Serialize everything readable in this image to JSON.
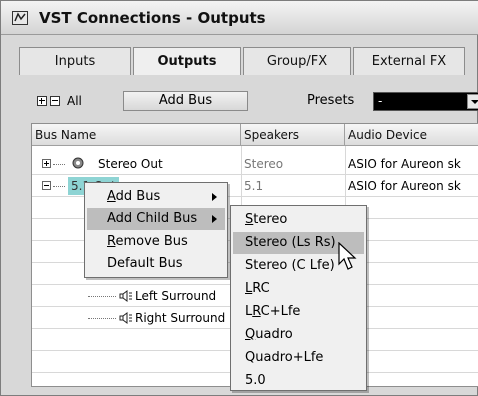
{
  "window": {
    "title": "VST Connections - Outputs"
  },
  "tabs": [
    {
      "label": "Inputs",
      "active": false
    },
    {
      "label": "Outputs",
      "active": true
    },
    {
      "label": "Group/FX",
      "active": false
    },
    {
      "label": "External FX",
      "active": false
    }
  ],
  "toolbar": {
    "all_label": "All",
    "add_bus_label": "Add Bus",
    "presets_label": "Presets",
    "presets_value": "-"
  },
  "table": {
    "headers": [
      "Bus Name",
      "Speakers",
      "Audio Device"
    ],
    "rows": [
      {
        "name": "Stereo Out",
        "speakers": "Stereo",
        "device": "ASIO for Aureon sk"
      },
      {
        "name": "5.1 Out",
        "speakers": "5.1",
        "device": "ASIO for Aureon sk"
      },
      {
        "name": "Left Surround",
        "speakers": "",
        "device": ""
      },
      {
        "name": "Right Surround",
        "speakers": "",
        "device": ""
      }
    ]
  },
  "context_menu": {
    "items": [
      {
        "pre": "",
        "ul": "A",
        "post": "dd Bus",
        "submenu": true
      },
      {
        "pre": "Add Child Bus",
        "ul": "",
        "post": "",
        "submenu": true,
        "highlighted": true
      },
      {
        "pre": "",
        "ul": "R",
        "post": "emove Bus",
        "submenu": false
      },
      {
        "pre": "Default Bus",
        "ul": "",
        "post": "",
        "submenu": false
      }
    ]
  },
  "child_bus_menu": {
    "items": [
      {
        "pre": "",
        "ul": "S",
        "post": "tereo"
      },
      {
        "pre": "Stereo (Ls Rs)",
        "ul": "",
        "post": "",
        "highlighted": true
      },
      {
        "pre": "Stereo (C Lfe)",
        "ul": "",
        "post": ""
      },
      {
        "pre": "",
        "ul": "L",
        "post": "RC"
      },
      {
        "pre": "L",
        "ul": "R",
        "post": "C+Lfe"
      },
      {
        "pre": "",
        "ul": "Q",
        "post": "uadro"
      },
      {
        "pre": "Quadro+Lfe",
        "ul": "",
        "post": ""
      },
      {
        "pre": "5.0",
        "ul": "",
        "post": ""
      }
    ]
  },
  "colors": {
    "highlight": "#bdbdbd",
    "selected_bus": "#8ed4d4"
  }
}
